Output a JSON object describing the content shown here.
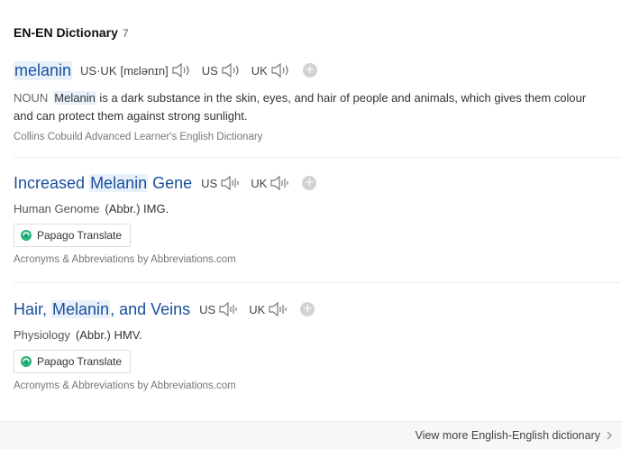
{
  "header": {
    "title": "EN-EN Dictionary",
    "count": "7"
  },
  "entries": [
    {
      "word": "melanin",
      "pron_label": "US·UK",
      "pron_text": "[mɛlənɪn]",
      "us": "US",
      "uk": "UK",
      "pos": "NOUN",
      "def_highlight": "Melanin",
      "def_rest": " is a dark substance in the skin, eyes, and hair of people and animals, which gives them colour and can protect them against strong sunlight.",
      "source": "Collins Cobuild Advanced Learner's English Dictionary"
    },
    {
      "word_pre": "Increased ",
      "word_hl": "Melanin",
      "word_post": " Gene",
      "us": "US",
      "uk": "UK",
      "category": "Human Genome",
      "abbr": "(Abbr.) IMG.",
      "translate": "Papago Translate",
      "source": "Acronyms & Abbreviations by Abbreviations.com"
    },
    {
      "word_pre": "Hair, ",
      "word_hl": "Melanin",
      "word_post": ", and Veins",
      "us": "US",
      "uk": "UK",
      "category": "Physiology",
      "abbr": "(Abbr.) HMV.",
      "translate": "Papago Translate",
      "source": "Acronyms & Abbreviations by Abbreviations.com"
    }
  ],
  "footer": {
    "more": "View more English-English dictionary"
  },
  "colors": {
    "link": "#1a4f9c",
    "highlight": "#e8f0fa"
  },
  "icons": {
    "speaker": "speaker-icon",
    "add": "plus-icon",
    "papago": "papago-icon",
    "chevron": "chevron-right-icon"
  }
}
